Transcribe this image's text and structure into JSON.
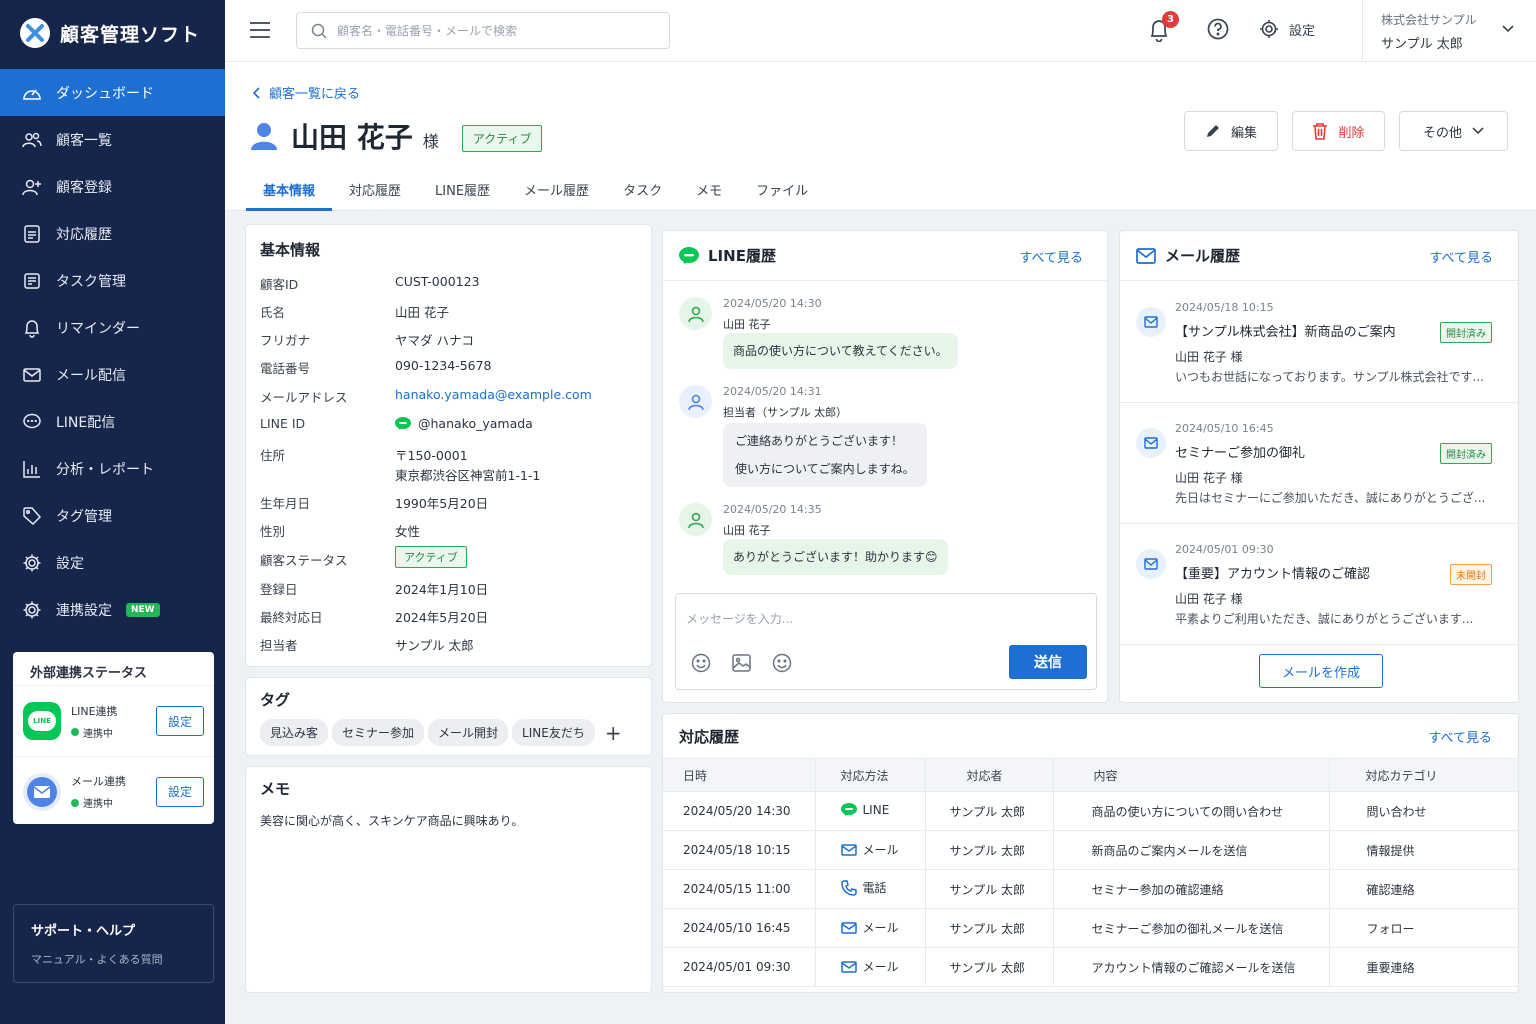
{
  "app": {
    "title": "顧客管理ソフト"
  },
  "sidebar": {
    "items": [
      {
        "label": "ダッシュボード",
        "icon": "dashboard-icon"
      },
      {
        "label": "顧客一覧",
        "icon": "users-icon"
      },
      {
        "label": "顧客登録",
        "icon": "user-plus-icon"
      },
      {
        "label": "対応履歴",
        "icon": "history-icon"
      },
      {
        "label": "タスク管理",
        "icon": "task-icon"
      },
      {
        "label": "リマインダー",
        "icon": "bell-icon"
      },
      {
        "label": "メール配信",
        "icon": "mail-icon"
      },
      {
        "label": "LINE配信",
        "icon": "chat-icon"
      },
      {
        "label": "分析・レポート",
        "icon": "chart-icon"
      },
      {
        "label": "タグ管理",
        "icon": "tag-icon"
      },
      {
        "label": "設定",
        "icon": "gear-icon"
      },
      {
        "label": "連携設定",
        "icon": "gear-icon",
        "badge": "NEW"
      }
    ],
    "integration": {
      "title": "外部連携ステータス",
      "line": {
        "name": "LINE連携",
        "status": "連携中",
        "button": "設定",
        "icon_text": "LINE"
      },
      "mail": {
        "name": "メール連携",
        "status": "連携中",
        "button": "設定"
      }
    },
    "support": {
      "title": "サポート・ヘルプ",
      "subtitle": "マニュアル・よくある質問"
    }
  },
  "topbar": {
    "search_placeholder": "顧客名・電話番号・メールで検索",
    "notification_count": "3",
    "settings_label": "設定",
    "company": "株式会社サンプル",
    "user": "サンプル 太郎"
  },
  "header": {
    "back_label": "顧客一覧に戻る",
    "customer_name": "山田 花子",
    "suffix": "様",
    "status": "アクティブ",
    "buttons": {
      "edit": "編集",
      "delete": "削除",
      "more": "その他"
    },
    "tabs": [
      "基本情報",
      "対応履歴",
      "LINE履歴",
      "メール履歴",
      "タスク",
      "メモ",
      "ファイル"
    ]
  },
  "basic_info": {
    "title": "基本情報",
    "rows": [
      {
        "label": "顧客ID",
        "value": "CUST-000123"
      },
      {
        "label": "氏名",
        "value": "山田 花子"
      },
      {
        "label": "フリガナ",
        "value": "ヤマダ ハナコ"
      },
      {
        "label": "電話番号",
        "value": "090-1234-5678"
      },
      {
        "label": "メールアドレス",
        "value": "hanako.yamada@example.com"
      },
      {
        "label": "LINE ID",
        "value": "@hanako_yamada"
      },
      {
        "label": "住所",
        "value": "〒150-0001",
        "value2": "東京都渋谷区神宮前1-1-1"
      },
      {
        "label": "生年月日",
        "value": "1990年5月20日"
      },
      {
        "label": "性別",
        "value": "女性"
      },
      {
        "label": "顧客ステータス",
        "value": "アクティブ"
      },
      {
        "label": "登録日",
        "value": "2024年1月10日"
      },
      {
        "label": "最終対応日",
        "value": "2024年5月20日"
      },
      {
        "label": "担当者",
        "value": "サンプル 太郎"
      }
    ]
  },
  "tags": {
    "title": "タグ",
    "items": [
      "見込み客",
      "セミナー参加",
      "メール開封",
      "LINE友だち"
    ],
    "add": "+"
  },
  "memo": {
    "title": "メモ",
    "text": "美容に関心が高く、スキンケア商品に興味あり。"
  },
  "line_history": {
    "title": "LINE履歴",
    "see_all": "すべて見る",
    "messages": [
      {
        "time": "2024/05/20 14:30",
        "sender": "山田 花子",
        "lines": [
          "商品の使い方について教えてください。"
        ]
      },
      {
        "time": "2024/05/20 14:31",
        "sender": "担当者（サンプル 太郎）",
        "lines": [
          "ご連絡ありがとうございます！",
          "使い方についてご案内しますね。"
        ]
      },
      {
        "time": "2024/05/20 14:35",
        "sender": "山田 花子",
        "lines": [
          "ありがとうございます！助かります😊"
        ]
      }
    ],
    "input_placeholder": "メッセージを入力...",
    "send": "送信"
  },
  "mail_history": {
    "title": "メール履歴",
    "see_all": "すべて見る",
    "items": [
      {
        "time": "2024/05/18 10:15",
        "subject": "【サンプル株式会社】新商品のご案内",
        "to": "山田 花子 様",
        "preview": "いつもお世話になっております。サンプル株式会社です...",
        "status": "開封済み",
        "status_color": "#2a8a43"
      },
      {
        "time": "2024/05/10 16:45",
        "subject": "セミナーご参加の御礼",
        "to": "山田 花子 様",
        "preview": "先日はセミナーにご参加いただき、誠にありがとうござ...",
        "status": "開封済み",
        "status_color": "#2a8a43"
      },
      {
        "time": "2024/05/01 09:30",
        "subject": "【重要】アカウント情報のご確認",
        "to": "山田 花子 様",
        "preview": "平素よりご利用いただき、誠にありがとうございます...",
        "status": "未開封",
        "status_color": "#e07b12"
      }
    ],
    "compose": "メールを作成"
  },
  "activity": {
    "title": "対応履歴",
    "see_all": "すべて見る",
    "columns": [
      "日時",
      "対応方法",
      "対応者",
      "内容",
      "対応カテゴリ"
    ],
    "rows": [
      {
        "date": "2024/05/20 14:30",
        "method": "LINE",
        "method_icon": "line-icon",
        "staff": "サンプル 太郎",
        "content": "商品の使い方についての問い合わせ",
        "category": "問い合わせ"
      },
      {
        "date": "2024/05/18 10:15",
        "method": "メール",
        "method_icon": "mail-icon",
        "staff": "サンプル 太郎",
        "content": "新商品のご案内メールを送信",
        "category": "情報提供"
      },
      {
        "date": "2024/05/15 11:00",
        "method": "電話",
        "method_icon": "phone-icon",
        "staff": "サンプル 太郎",
        "content": "セミナー参加の確認連絡",
        "category": "確認連絡"
      },
      {
        "date": "2024/05/10 16:45",
        "method": "メール",
        "method_icon": "mail-icon",
        "staff": "サンプル 太郎",
        "content": "セミナーご参加の御礼メールを送信",
        "category": "フォロー"
      },
      {
        "date": "2024/05/01 09:30",
        "method": "メール",
        "method_icon": "mail-icon",
        "staff": "サンプル 太郎",
        "content": "アカウント情報のご確認メールを送信",
        "category": "重要連絡"
      }
    ]
  },
  "colors": {
    "sidebar": "#16264a",
    "accent": "#1d6fd1",
    "line_green": "#06c755",
    "danger": "#e33b3b"
  }
}
